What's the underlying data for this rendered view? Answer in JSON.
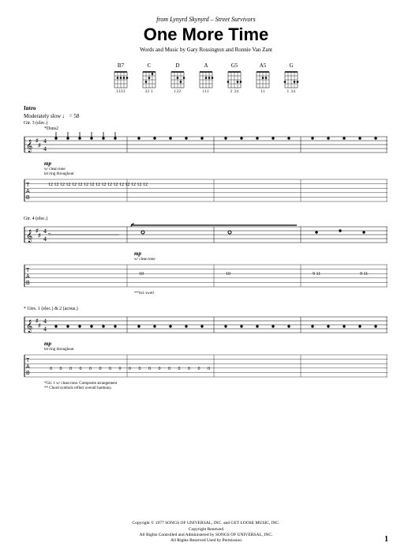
{
  "header": {
    "source": "from Lynyrd Skynyrd – Street Survivors",
    "title": "One More Time",
    "credits": "Words and Music by Gary Rossington and Ronnie Van Zant"
  },
  "chords": [
    {
      "name": "B7",
      "fingering": "1333"
    },
    {
      "name": "C",
      "fingering": "32 1"
    },
    {
      "name": "D",
      "fingering": "132"
    },
    {
      "name": "A",
      "fingering": "111"
    },
    {
      "name": "G5",
      "fingering": "2 34"
    },
    {
      "name": "A5",
      "fingering": "11"
    },
    {
      "name": "G",
      "fingering": "1 34"
    }
  ],
  "intro": {
    "label": "Intro",
    "tempo": "Moderately slow ♩ = 58",
    "chord_mark": "*Dsus2"
  },
  "system1": {
    "part": "Gtr. 3 (elec.)",
    "dynamic": "mp",
    "note1": "w/ clean tone",
    "note2": "let ring throughout",
    "tab_line": "12  12  12  12  12   12  12  12  12   12  12  12  12   12  12  12  12"
  },
  "system2": {
    "part": "Gtr. 4 (elec.)",
    "dynamic": "mp",
    "note1": "w/ clean tone",
    "tab_vals": "10   10         10        9 11       9 11",
    "vol_note": "**Vol. swell"
  },
  "system3": {
    "part": "* Gtrs. 1 (elec.) & 2 (acous.)",
    "dynamic": "mp",
    "note1": "let ring throughout",
    "tab_line": "0  0  0  0  0   0  0  0  0   0  0  0  0   0  0  0  0",
    "foot1": "*Gtr. 1 w/ clean tone. Composite arrangement",
    "foot2": "** Chord symbols reflect overall harmony."
  },
  "footer": {
    "line1": "Copyright © 1977 SONGS OF UNIVERSAL, INC. and GET LOOSE MUSIC, INC.",
    "line2": "Copyright Renewed",
    "line3": "All Rights Controlled and Administered by SONGS OF UNIVERSAL, INC.",
    "line4": "All Rights Reserved   Used by Permission",
    "pagenum": "1"
  }
}
